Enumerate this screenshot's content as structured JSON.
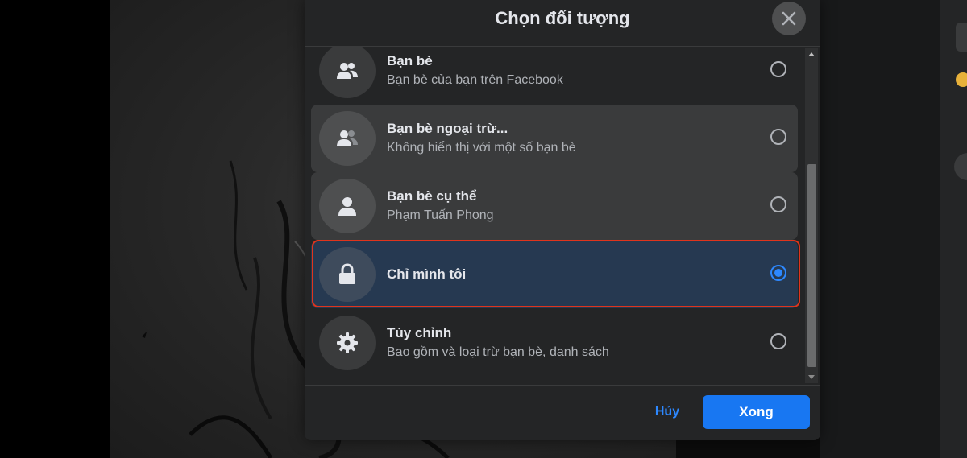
{
  "dialog": {
    "title": "Chọn đối tượng",
    "close_icon": "close-icon"
  },
  "options": [
    {
      "title": "Bạn bè",
      "subtitle": "Bạn bè của bạn trên Facebook",
      "icon": "friends-icon",
      "selected": false
    },
    {
      "title": "Bạn bè ngoại trừ...",
      "subtitle": "Không hiển thị với một số bạn bè",
      "icon": "friends-except-icon",
      "selected": false
    },
    {
      "title": "Bạn bè cụ thể",
      "subtitle": "Phạm Tuấn Phong",
      "icon": "person-icon",
      "selected": false
    },
    {
      "title": "Chỉ mình tôi",
      "subtitle": "",
      "icon": "lock-icon",
      "selected": true
    },
    {
      "title": "Tùy chỉnh",
      "subtitle": "Bao gồm và loại trừ bạn bè, danh sách",
      "icon": "gear-icon",
      "selected": false
    }
  ],
  "footer": {
    "cancel_label": "Hủy",
    "done_label": "Xong"
  },
  "colors": {
    "accent": "#1877f2",
    "link": "#2d88ff",
    "highlight": "#e0341c",
    "dialog_bg": "#242526",
    "selected_bg": "#263951"
  }
}
